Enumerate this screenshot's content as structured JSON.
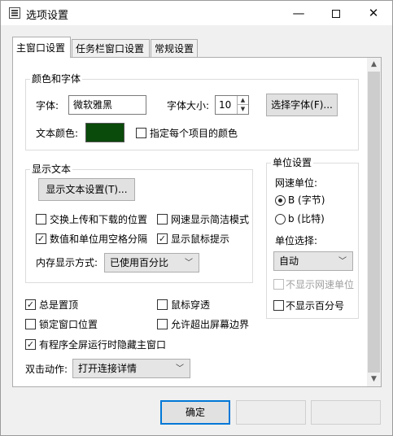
{
  "window": {
    "title": "选项设置",
    "icons": {
      "app": "app-settings-icon",
      "minimize": "minimize-icon",
      "maximize": "maximize-icon",
      "close": "close-icon"
    }
  },
  "tabs": [
    "主窗口设置",
    "任务栏窗口设置",
    "常规设置"
  ],
  "font_group": {
    "title": "颜色和字体",
    "font_label": "字体:",
    "font_value": "微软雅黑",
    "size_label": "字体大小:",
    "size_value": "10",
    "choose_font_button": "选择字体(F)...",
    "color_label": "文本颜色:",
    "color_value": "#0a4a0a",
    "per_item_color": {
      "label": "指定每个项目的颜色",
      "checked": false
    }
  },
  "display_group": {
    "title": "显示文本",
    "settings_button": "显示文本设置(T)...",
    "options": [
      {
        "label": "交换上传和下载的位置",
        "checked": false
      },
      {
        "label": "网速显示简洁模式",
        "checked": false
      },
      {
        "label": "数值和单位用空格分隔",
        "checked": true
      },
      {
        "label": "显示鼠标提示",
        "checked": true
      }
    ],
    "memory_label": "内存显示方式:",
    "memory_value": "已使用百分比"
  },
  "unit_group": {
    "title": "单位设置",
    "speed_unit_label": "网速单位:",
    "radios": [
      {
        "label": "B (字节)",
        "selected": true
      },
      {
        "label": "b (比特)",
        "selected": false
      }
    ],
    "unit_select_label": "单位选择:",
    "unit_select_value": "自动",
    "hide_speed_unit": {
      "label": "不显示网速单位",
      "checked": false,
      "disabled": true
    },
    "hide_percent": {
      "label": "不显示百分号",
      "checked": false
    }
  },
  "general_options": [
    {
      "label": "总是置顶",
      "checked": true
    },
    {
      "label": "鼠标穿透",
      "checked": false
    },
    {
      "label": "锁定窗口位置",
      "checked": false
    },
    {
      "label": "允许超出屏幕边界",
      "checked": false
    },
    {
      "label": "有程序全屏运行时隐藏主窗口",
      "checked": true
    }
  ],
  "double_click": {
    "label": "双击动作:",
    "value": "打开连接详情"
  },
  "footer": {
    "ok_button": "确定"
  }
}
